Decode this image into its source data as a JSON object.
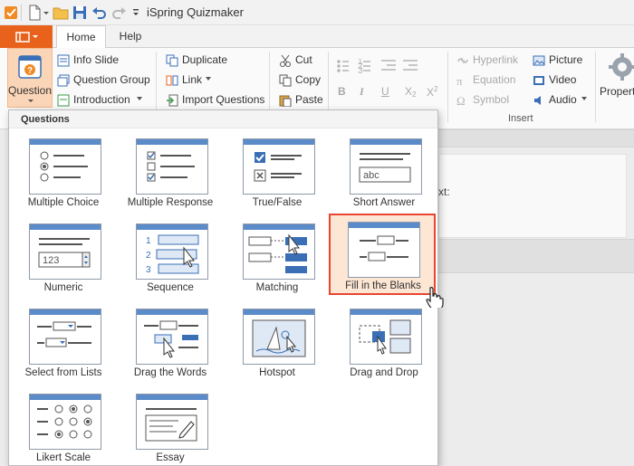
{
  "window": {
    "title": "iSpring Quizmaker"
  },
  "tabs": [
    {
      "label": "Home",
      "active": true
    },
    {
      "label": "Help",
      "active": false
    }
  ],
  "ribbon": {
    "question_button": "Question",
    "slides": {
      "info_slide": "Info Slide",
      "question_group": "Question Group",
      "introduction": "Introduction"
    },
    "actions": {
      "duplicate": "Duplicate",
      "link": "Link",
      "import_questions": "Import Questions"
    },
    "clipboard": {
      "cut": "Cut",
      "copy": "Copy",
      "paste": "Paste"
    },
    "formatting": {
      "bold": "B",
      "italic": "I",
      "underline": "U",
      "subscript": "X",
      "subscript_mark": "2",
      "superscript": "X",
      "superscript_mark": "2"
    },
    "insert": {
      "hyperlink": "Hyperlink",
      "equation": "Equation",
      "symbol": "Symbol",
      "picture": "Picture",
      "video": "Video",
      "audio": "Audio",
      "group_label": "Insert"
    },
    "properties": "Propert"
  },
  "background": {
    "partial_text": "xt:"
  },
  "dropdown": {
    "title": "Questions",
    "items": [
      {
        "label": "Multiple Choice",
        "icon": "multiple-choice-icon",
        "selected": false
      },
      {
        "label": "Multiple Response",
        "icon": "multiple-response-icon",
        "selected": false
      },
      {
        "label": "True/False",
        "icon": "true-false-icon",
        "selected": false
      },
      {
        "label": "Short Answer",
        "icon": "short-answer-icon",
        "selected": false
      },
      {
        "label": "Numeric",
        "icon": "numeric-icon",
        "selected": false
      },
      {
        "label": "Sequence",
        "icon": "sequence-icon",
        "selected": false
      },
      {
        "label": "Matching",
        "icon": "matching-icon",
        "selected": false
      },
      {
        "label": "Fill in the Blanks",
        "icon": "fill-in-the-blanks-icon",
        "selected": true
      },
      {
        "label": "Select from Lists",
        "icon": "select-from-lists-icon",
        "selected": false
      },
      {
        "label": "Drag the Words",
        "icon": "drag-the-words-icon",
        "selected": false
      },
      {
        "label": "Hotspot",
        "icon": "hotspot-icon",
        "selected": false
      },
      {
        "label": "Drag and Drop",
        "icon": "drag-and-drop-icon",
        "selected": false
      },
      {
        "label": "Likert Scale",
        "icon": "likert-scale-icon",
        "selected": false
      },
      {
        "label": "Essay",
        "icon": "essay-icon",
        "selected": false
      }
    ],
    "short_answer_sample": "abc",
    "numeric_sample": "123",
    "sequence_numbers": [
      "1",
      "2",
      "3"
    ]
  },
  "colors": {
    "accent": "#e8621c",
    "selection_border": "#e8462f",
    "selection_fill": "#fde6d3",
    "icon_bar": "#5b8bc9"
  }
}
